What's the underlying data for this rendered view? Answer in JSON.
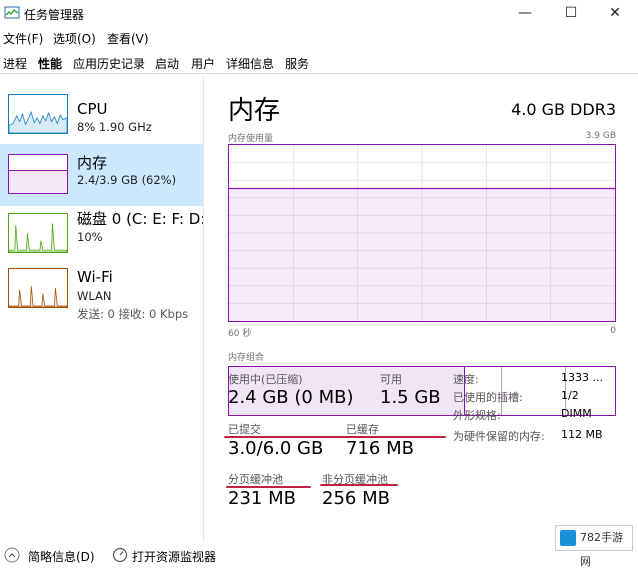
{
  "window": {
    "title": "任务管理器",
    "min": "—",
    "max": "☐",
    "close": "✕"
  },
  "menu": [
    "文件(F)",
    "选项(O)",
    "查看(V)"
  ],
  "tabs": [
    "进程",
    "性能",
    "应用历史记录",
    "启动",
    "用户",
    "详细信息",
    "服务"
  ],
  "sidebar": [
    {
      "name": "CPU",
      "sub": "8% 1.90 GHz"
    },
    {
      "name": "内存",
      "sub": "2.4/3.9 GB (62%)"
    },
    {
      "name": "磁盘 0 (C: E: F: D:",
      "sub": "10%"
    },
    {
      "name": "Wi-Fi",
      "sub": "WLAN",
      "sub2": "发送: 0 接收: 0 Kbps"
    }
  ],
  "main": {
    "title": "内存",
    "spec": "4.0 GB DDR3",
    "usage_label": "内存使用量",
    "usage_max": "3.9 GB",
    "time_left": "60 秒",
    "time_right": "0",
    "composition_label": "内存组合",
    "stats": {
      "in_use_label": "使用中(已压缩)",
      "in_use_value": "2.4 GB (0 MB)",
      "available_label": "可用",
      "available_value": "1.5 GB",
      "committed_label": "已提交",
      "committed_value": "3.0/6.0 GB",
      "cached_label": "已缓存",
      "cached_value": "716 MB",
      "paged_label": "分页缓冲池",
      "paged_value": "231 MB",
      "nonpaged_label": "非分页缓冲池",
      "nonpaged_value": "256 MB"
    },
    "details": [
      {
        "k": "速度:",
        "v": "1333 ..."
      },
      {
        "k": "已使用的插槽:",
        "v": "1/2"
      },
      {
        "k": "外形规格:",
        "v": "DIMM"
      },
      {
        "k": "为硬件保留的内存:",
        "v": "112 MB"
      }
    ]
  },
  "footer": {
    "summary": "简略信息(D)",
    "monitor": "打开资源监视器"
  },
  "badge": {
    "text": "782手游网"
  },
  "colors": {
    "memory": "#8b12ae",
    "cpu": "#117dbb",
    "disk": "#4da60c",
    "wifi": "#a74f01",
    "selected": "#cce8ff",
    "underline": "#c0213f"
  }
}
